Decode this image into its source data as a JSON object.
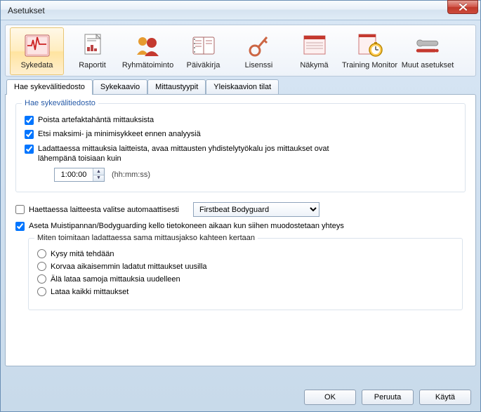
{
  "window": {
    "title": "Asetukset"
  },
  "toolbar": {
    "items": [
      {
        "label": "Sykedata"
      },
      {
        "label": "Raportit"
      },
      {
        "label": "Ryhmätoiminto"
      },
      {
        "label": "Päiväkirja"
      },
      {
        "label": "Lisenssi"
      },
      {
        "label": "Näkymä"
      },
      {
        "label": "Training Monitor"
      },
      {
        "label": "Muut asetukset"
      }
    ]
  },
  "tabs": [
    {
      "label": "Hae sykevälitiedosto"
    },
    {
      "label": "Sykekaavio"
    },
    {
      "label": "Mittaustyypit"
    },
    {
      "label": "Yleiskaavion tilat"
    }
  ],
  "group1": {
    "legend": "Hae sykevälitiedosto",
    "cb_artefact": "Poista artefaktahäntä mittauksista",
    "cb_minmax": "Etsi maksimi- ja minimisykkeet ennen analyysiä",
    "cb_combine": "Ladattaessa mittauksia laitteista, avaa mittausten yhdistelytyökalu jos mittaukset ovat lähempänä toisiaan kuin",
    "time_value": "1:00:00",
    "time_hint": "(hh:mm:ss)"
  },
  "cb_autoselect": "Haettaessa laitteesta valitse automaattisesti",
  "dropdown_value": "Firstbeat Bodyguard",
  "cb_clock": "Aseta Muistipannan/Bodyguarding kello tietokoneen aikaan kun siihen muodostetaan yhteys",
  "group2": {
    "legend": "Miten toimitaan ladattaessa sama mittausjakso kahteen kertaan",
    "r1": "Kysy mitä tehdään",
    "r2": "Korvaa aikaisemmin ladatut mittaukset uusilla",
    "r3": "Älä lataa samoja mittauksia uudelleen",
    "r4": "Lataa kaikki mittaukset"
  },
  "buttons": {
    "ok": "OK",
    "cancel": "Peruuta",
    "apply": "Käytä"
  }
}
